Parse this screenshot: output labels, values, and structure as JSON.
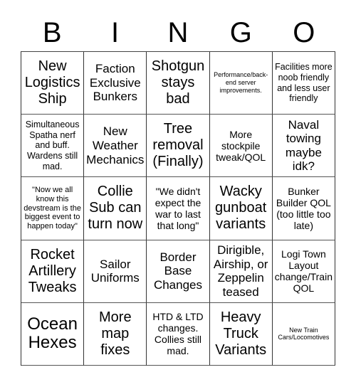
{
  "header": {
    "letters": [
      "B",
      "I",
      "N",
      "G",
      "O"
    ]
  },
  "board": {
    "rows": [
      [
        {
          "text": "New Logistics Ship"
        },
        {
          "text": "Faction Exclusive Bunkers"
        },
        {
          "text": "Shotgun stays bad"
        },
        {
          "text": "Performance/back-end server improvements."
        },
        {
          "text": "Facilities more noob friendly and less user friendly"
        }
      ],
      [
        {
          "text": "Simultaneous Spatha nerf and buff. Wardens still mad."
        },
        {
          "text": "New Weather Mechanics"
        },
        {
          "text": "Tree removal (Finally)"
        },
        {
          "text": "More stockpile tweak/QOL"
        },
        {
          "text": "Naval towing maybe idk?"
        }
      ],
      [
        {
          "text": "\"Now we all know this devstream is the biggest event to happen today\""
        },
        {
          "text": "Collie Sub can turn now"
        },
        {
          "text": "\"We didn't expect the war to last that long\""
        },
        {
          "text": "Wacky gunboat variants"
        },
        {
          "text": "Bunker Builder QOL (too little too late)"
        }
      ],
      [
        {
          "text": "Rocket Artillery Tweaks"
        },
        {
          "text": "Sailor Uniforms"
        },
        {
          "text": "Border Base Changes"
        },
        {
          "text": "Dirigible, Airship, or Zeppelin teased"
        },
        {
          "text": "Logi Town Layout change/Train QOL"
        }
      ],
      [
        {
          "text": "Ocean Hexes"
        },
        {
          "text": "More map fixes"
        },
        {
          "text": "HTD & LTD changes. Collies still mad."
        },
        {
          "text": "Heavy Truck Variants"
        },
        {
          "text": "New Train Cars/Locomotives"
        }
      ]
    ]
  }
}
